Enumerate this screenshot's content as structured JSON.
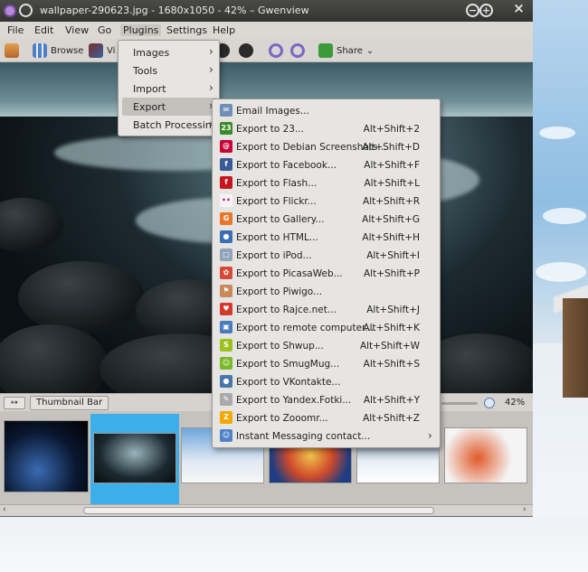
{
  "window": {
    "title": "wallpaper-290623.jpg - 1680x1050 - 42% – Gwenview",
    "minimize_glyph": "−",
    "maximize_glyph": "+",
    "close_glyph": "×"
  },
  "menubar": {
    "items": [
      {
        "label": "File"
      },
      {
        "label": "Edit"
      },
      {
        "label": "View"
      },
      {
        "label": "Go"
      },
      {
        "label": "Plugins"
      },
      {
        "label": "Settings"
      },
      {
        "label": "Help"
      }
    ]
  },
  "toolbar": {
    "browse_label": "Browse",
    "view_label": "Vi",
    "share_label": "Share",
    "share_dropdown": "⌄"
  },
  "plugins_menu": {
    "items": [
      {
        "label": "Images",
        "arrow": "›"
      },
      {
        "label": "Tools",
        "arrow": "›"
      },
      {
        "label": "Import",
        "arrow": "›"
      },
      {
        "label": "Export",
        "arrow": "›"
      },
      {
        "label": "Batch Processing",
        "arrow": "›"
      }
    ]
  },
  "export_menu": {
    "items": [
      {
        "label": "Email Images...",
        "shortcut": "",
        "icon": "email-icon",
        "color": "#6f8fb4",
        "glyph": "✉"
      },
      {
        "label": "Export to 23...",
        "shortcut": "Alt+Shift+2",
        "icon": "twentythree-icon",
        "color": "#3a8a2a",
        "glyph": "23"
      },
      {
        "label": "Export to Debian Screenshots...",
        "shortcut": "Alt+Shift+D",
        "icon": "debian-icon",
        "color": "#c70036",
        "glyph": "@"
      },
      {
        "label": "Export to Facebook...",
        "shortcut": "Alt+Shift+F",
        "icon": "facebook-icon",
        "color": "#3b5998",
        "glyph": "f"
      },
      {
        "label": "Export to Flash...",
        "shortcut": "Alt+Shift+L",
        "icon": "flash-icon",
        "color": "#c4161c",
        "glyph": "f"
      },
      {
        "label": "Export to Flickr...",
        "shortcut": "Alt+Shift+R",
        "icon": "flickr-icon",
        "color": "#f5f5f5",
        "glyph": "••"
      },
      {
        "label": "Export to Gallery...",
        "shortcut": "Alt+Shift+G",
        "icon": "gallery-icon",
        "color": "#e8762b",
        "glyph": "G"
      },
      {
        "label": "Export to HTML...",
        "shortcut": "Alt+Shift+H",
        "icon": "html-icon",
        "color": "#3a6db5",
        "glyph": "●"
      },
      {
        "label": "Export to iPod...",
        "shortcut": "Alt+Shift+I",
        "icon": "ipod-icon",
        "color": "#8fa4bc",
        "glyph": "□"
      },
      {
        "label": "Export to PicasaWeb...",
        "shortcut": "Alt+Shift+P",
        "icon": "picasaweb-icon",
        "color": "#d84a38",
        "glyph": "✿"
      },
      {
        "label": "Export to Piwigo...",
        "shortcut": "",
        "icon": "piwigo-icon",
        "color": "#c98a5a",
        "glyph": "⚑"
      },
      {
        "label": "Export to Rajce.net...",
        "shortcut": "Alt+Shift+J",
        "icon": "rajce-icon",
        "color": "#d33a2c",
        "glyph": "♥"
      },
      {
        "label": "Export to remote computer...",
        "shortcut": "Alt+Shift+K",
        "icon": "remote-computer-icon",
        "color": "#4a7ac0",
        "glyph": "▣"
      },
      {
        "label": "Export to Shwup...",
        "shortcut": "Alt+Shift+W",
        "icon": "shwup-icon",
        "color": "#9cc21f",
        "glyph": "S"
      },
      {
        "label": "Export to SmugMug...",
        "shortcut": "Alt+Shift+S",
        "icon": "smugmug-icon",
        "color": "#7bb82a",
        "glyph": "☺"
      },
      {
        "label": "Export to VKontakte...",
        "shortcut": "",
        "icon": "vkontakte-icon",
        "color": "#4a76a8",
        "glyph": "●"
      },
      {
        "label": "Export to Yandex.Fotki...",
        "shortcut": "Alt+Shift+Y",
        "icon": "yandex-fotki-icon",
        "color": "#aaaaaa",
        "glyph": "✎"
      },
      {
        "label": "Export to Zooomr...",
        "shortcut": "Alt+Shift+Z",
        "icon": "zooomr-icon",
        "color": "#f2a900",
        "glyph": "Z"
      },
      {
        "label": "Instant Messaging contact...",
        "shortcut": "",
        "icon": "im-contact-icon",
        "color": "#4f83c9",
        "glyph": "☺",
        "has_submenu": true,
        "arrow": "›"
      }
    ]
  },
  "statusbar": {
    "thumb_toggle": "↦",
    "thumbnail_bar_label": "Thumbnail Bar",
    "zoom_value": "42%"
  },
  "scrollbar": {
    "left_arrow": "‹",
    "right_arrow": "›"
  }
}
